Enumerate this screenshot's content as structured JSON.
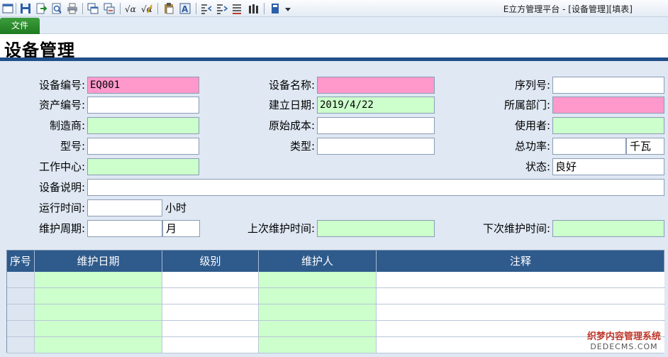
{
  "window": {
    "title": "E立方管理平台 - [设备管理][填表]"
  },
  "ribbon": {
    "file_tab": "文件"
  },
  "page": {
    "title": "设备管理"
  },
  "form": {
    "equipment_no": {
      "label": "设备编号:",
      "value": "EQ001"
    },
    "equipment_name": {
      "label": "设备名称:",
      "value": ""
    },
    "serial_no": {
      "label": "序列号:",
      "value": ""
    },
    "asset_no": {
      "label": "资产编号:",
      "value": ""
    },
    "created_date": {
      "label": "建立日期:",
      "value": "2019/4/22"
    },
    "department": {
      "label": "所属部门:",
      "value": ""
    },
    "manufacturer": {
      "label": "制造商:",
      "value": ""
    },
    "original_cost": {
      "label": "原始成本:",
      "value": ""
    },
    "user": {
      "label": "使用者:",
      "value": ""
    },
    "model": {
      "label": "型号:",
      "value": ""
    },
    "type": {
      "label": "类型:",
      "value": ""
    },
    "total_power": {
      "label": "总功率:",
      "value": "",
      "unit": "千瓦"
    },
    "work_center": {
      "label": "工作中心:",
      "value": ""
    },
    "status": {
      "label": "状态:",
      "value": "良好"
    },
    "description": {
      "label": "设备说明:",
      "value": ""
    },
    "run_time": {
      "label": "运行时间:",
      "value": "",
      "unit": "小时"
    },
    "maintenance_cycle": {
      "label": "维护周期:",
      "value": "",
      "unit": "月"
    },
    "last_maintenance": {
      "label": "上次维护时间:",
      "value": ""
    },
    "next_maintenance": {
      "label": "下次维护时间:",
      "value": ""
    }
  },
  "grid": {
    "columns": [
      "序号",
      "维护日期",
      "级别",
      "维护人",
      "注释"
    ],
    "rows": [
      [
        "",
        "",
        "",
        "",
        ""
      ],
      [
        "",
        "",
        "",
        "",
        ""
      ],
      [
        "",
        "",
        "",
        "",
        ""
      ],
      [
        "",
        "",
        "",
        "",
        ""
      ],
      [
        "",
        "",
        "",
        "",
        ""
      ]
    ]
  },
  "toolbar": {
    "icons": [
      "window-icon",
      "save-icon",
      "export-icon",
      "preview-icon",
      "print-icon",
      "copy-window-icon",
      "paste-window-icon",
      "formula-icon",
      "formula-edit-icon",
      "clipboard-icon",
      "text-format-icon",
      "align-left-icon",
      "align-right-icon",
      "field-list-icon",
      "column-icon",
      "book-icon",
      "dropdown-arrow-icon"
    ]
  },
  "watermark": {
    "line1": "织梦内容管理系统",
    "line2": "DEDECMS.COM"
  },
  "colors": {
    "required": "#ff99cc",
    "lookup": "#ccffcc",
    "header_rule": "#1f4e8a",
    "grid_header": "#2e5a8c",
    "file_tab": "#2a8a2a"
  }
}
